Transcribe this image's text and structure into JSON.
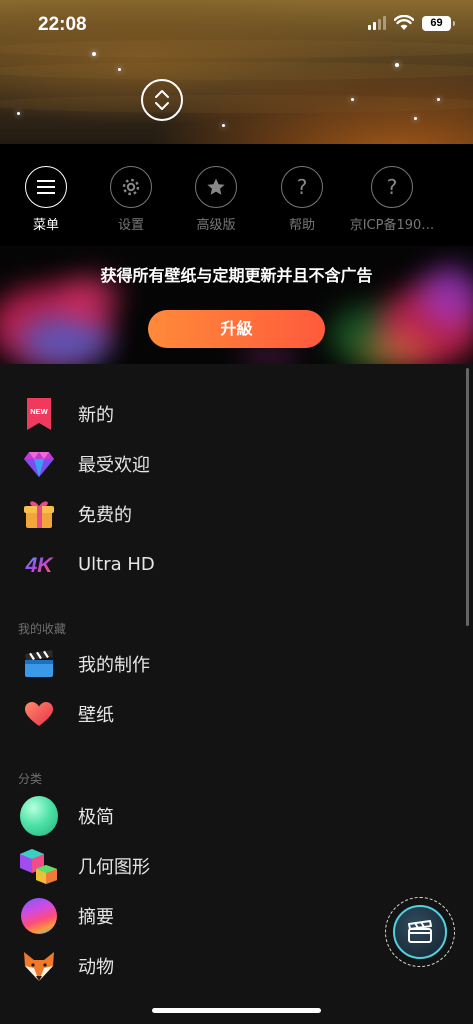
{
  "status": {
    "time": "22:08",
    "battery": "69"
  },
  "toolbar": [
    {
      "label": "菜单",
      "icon": "menu-icon"
    },
    {
      "label": "设置",
      "icon": "gear-icon"
    },
    {
      "label": "高级版",
      "icon": "star-icon"
    },
    {
      "label": "帮助",
      "icon": "help-icon"
    },
    {
      "label": "京ICP备190…",
      "icon": "help-icon"
    }
  ],
  "promo": {
    "text": "获得所有壁纸与定期更新并且不含广告",
    "button": "升級"
  },
  "menu": {
    "main": [
      {
        "label": "新的",
        "icon": "new-badge-icon",
        "badge": "NEW"
      },
      {
        "label": "最受欢迎",
        "icon": "diamond-icon"
      },
      {
        "label": "免费的",
        "icon": "gift-icon"
      },
      {
        "label": "Ultra HD",
        "icon": "4k-icon",
        "badge": "4K"
      }
    ],
    "favorites_header": "我的收藏",
    "favorites": [
      {
        "label": "我的制作",
        "icon": "clapperboard-icon"
      },
      {
        "label": "壁纸",
        "icon": "heart-icon"
      }
    ],
    "categories_header": "分类",
    "categories": [
      {
        "label": "极简",
        "icon": "green-orb-icon"
      },
      {
        "label": "几何图形",
        "icon": "cube-icon"
      },
      {
        "label": "摘要",
        "icon": "abstract-sphere-icon"
      },
      {
        "label": "动物",
        "icon": "fox-icon"
      }
    ]
  },
  "colors": {
    "accent_start": "#ff8a3a",
    "accent_end": "#ff5a3c",
    "background": "#131313"
  }
}
